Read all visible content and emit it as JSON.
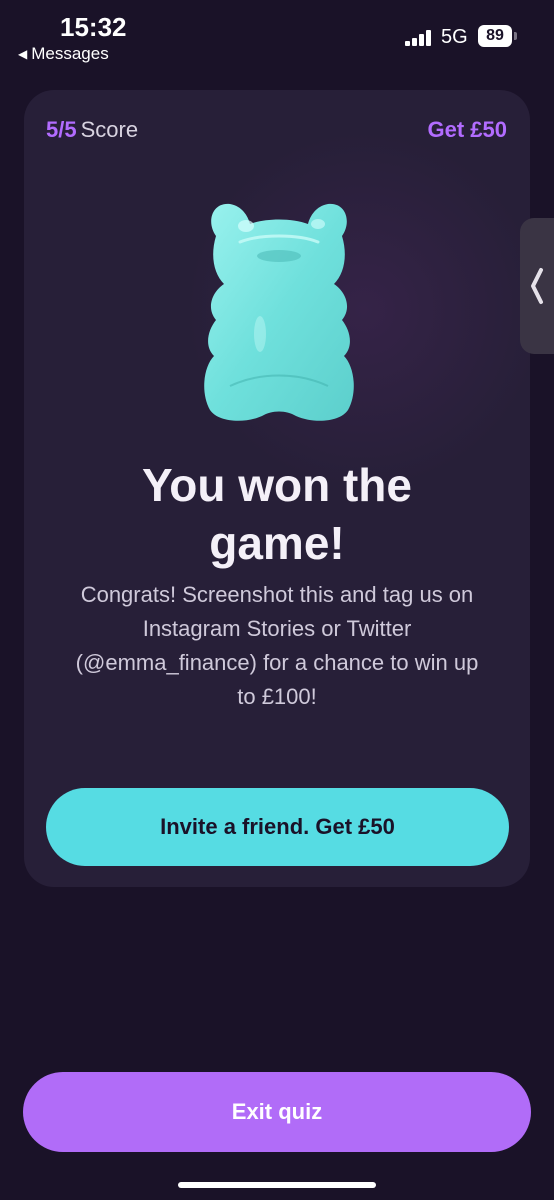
{
  "status_bar": {
    "time": "15:32",
    "back_app_label": "Messages",
    "network": "5G",
    "battery": "89"
  },
  "card": {
    "score_value": "5/5",
    "score_label": "Score",
    "reward_link": "Get £50",
    "headline": "You won the game!",
    "body": "Congrats! Screenshot this and tag us on Instagram Stories or Twitter (@emma_finance) for a chance to win up to £100!",
    "invite_button_label": "Invite a friend. Get £50"
  },
  "footer": {
    "exit_button_label": "Exit quiz"
  },
  "colors": {
    "background": "#1a1228",
    "card": "#271f38",
    "accent_purple": "#b26cff",
    "accent_teal": "#56dce3",
    "bear": "#7de8e4"
  },
  "icons": {
    "back": "back-arrow-icon",
    "signal": "cellular-signal-icon",
    "battery": "battery-icon",
    "side_handle": "chevron-left-icon",
    "hero": "gummy-bear-icon"
  }
}
